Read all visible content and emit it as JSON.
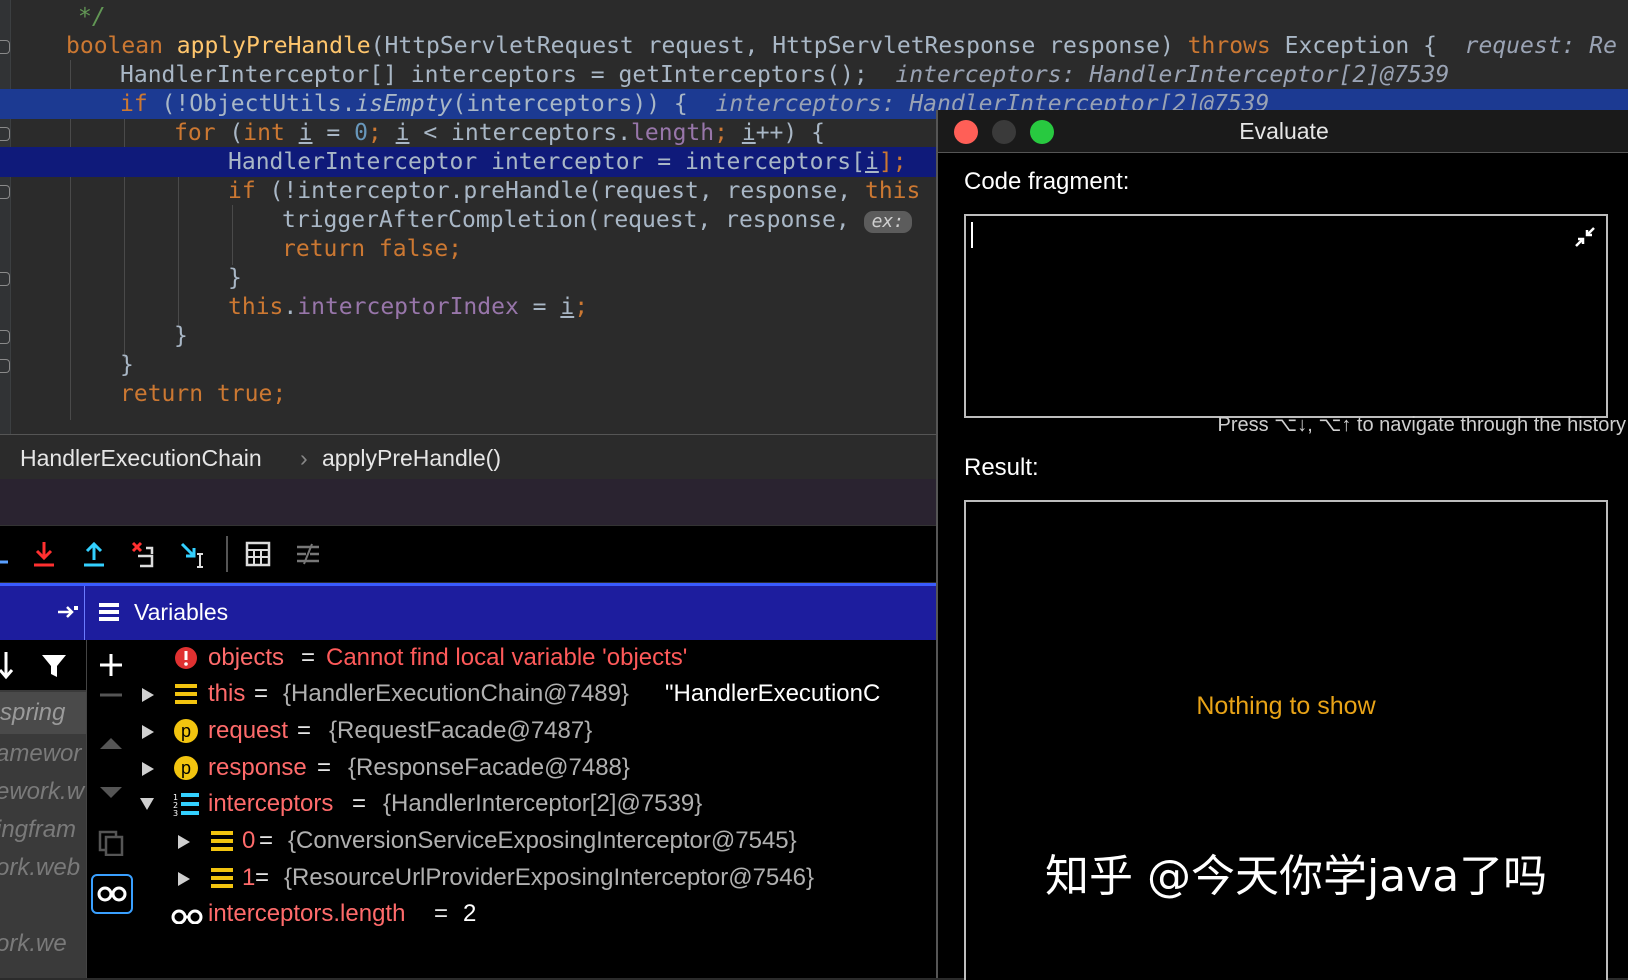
{
  "editor": {
    "lines": [
      {
        "text": "*/"
      },
      {
        "sig_kw": "boolean",
        "sig_name": "applyPreHandle",
        "sig_rest": "(HttpServletRequest request, HttpServletResponse response) ",
        "throws_kw": "throws",
        "throws_rest": " Exception {",
        "hint": "request: Re"
      },
      {
        "text": "HandlerInterceptor[] interceptors = getInterceptors();",
        "hint": "interceptors: HandlerInterceptor[2]@7539"
      },
      {
        "if_kw": "if",
        "a": " (!ObjectUtils.",
        "b": "isEmpty",
        "c": "(interceptors)) {",
        "hint": "interceptors: HandlerInterceptor[2]@7539"
      },
      {
        "for_kw": "for",
        "int_kw": "int",
        "var": "i",
        "zero": "0",
        "len": "length",
        "rest_open": " (",
        "rest_mid": " = ",
        "rest_semi": "; ",
        "lt": " < interceptors.",
        "inc": "++) {"
      },
      {
        "text": "HandlerInterceptor interceptor = interceptors[",
        "idx": "i",
        "end": "];"
      },
      {
        "if_kw": "if",
        "text": " (!interceptor.preHandle(request, response, ",
        "this_kw": "this"
      },
      {
        "text": "triggerAfterCompletion(request, response, ",
        "badge": "ex:"
      },
      {
        "return_kw": "return false;"
      },
      {
        "text": "}"
      },
      {
        "this_kw": "this",
        "dot": ".",
        "field": "interceptorIndex",
        "eq": " = ",
        "var": "i",
        "semi": ";"
      },
      {
        "text": "}"
      },
      {
        "text": "}"
      },
      {
        "return_kw": "return true;"
      }
    ]
  },
  "breadcrumb": {
    "class": "HandlerExecutionChain",
    "sep": "›",
    "method": "applyPreHandle()"
  },
  "variables": {
    "title": "Variables",
    "rows": [
      {
        "name": "objects",
        "eq": " = ",
        "value": "Cannot find local variable 'objects'",
        "icon": "error-icon"
      },
      {
        "name": "this",
        "eq": " = ",
        "value": "{HandlerExecutionChain@7489}",
        "extra": " \"HandlerExecutionC",
        "icon": "field-icon"
      },
      {
        "name": "request",
        "eq": " = ",
        "value": "{RequestFacade@7487}",
        "icon": "param-icon"
      },
      {
        "name": "response",
        "eq": " = ",
        "value": "{ResponseFacade@7488}",
        "icon": "param-icon"
      },
      {
        "name": "interceptors",
        "eq": " = ",
        "value": "{HandlerInterceptor[2]@7539}",
        "icon": "array-icon"
      },
      {
        "name": "0",
        "eq": " = ",
        "value": "{ConversionServiceExposingInterceptor@7545}",
        "icon": "field-icon"
      },
      {
        "name": "1",
        "eq": " = ",
        "value": "{ResourceUrlProviderExposingInterceptor@7546}",
        "icon": "field-icon"
      },
      {
        "name": "interceptors.length",
        "eq": " = ",
        "value": "2",
        "icon": "watch-icon"
      }
    ],
    "param_badge": "p"
  },
  "frames": [
    "spring",
    "amewor",
    "ework.w",
    "ingfram",
    "ork.web",
    "ork.we"
  ],
  "evaluate": {
    "title": "Evaluate",
    "code_label": "Code fragment:",
    "history_hint": "Press ⌥↓, ⌥↑ to navigate through the history",
    "result_label": "Result:",
    "empty": "Nothing to show"
  },
  "watermark": "知乎 @今天你学java了吗",
  "colors": {
    "highlight": "#1c3a92",
    "var_header": "#1d1d9e",
    "keyword": "#cc7832",
    "method": "#ffc66d",
    "error": "#ff5a5a",
    "empty_text": "#e8a317"
  }
}
